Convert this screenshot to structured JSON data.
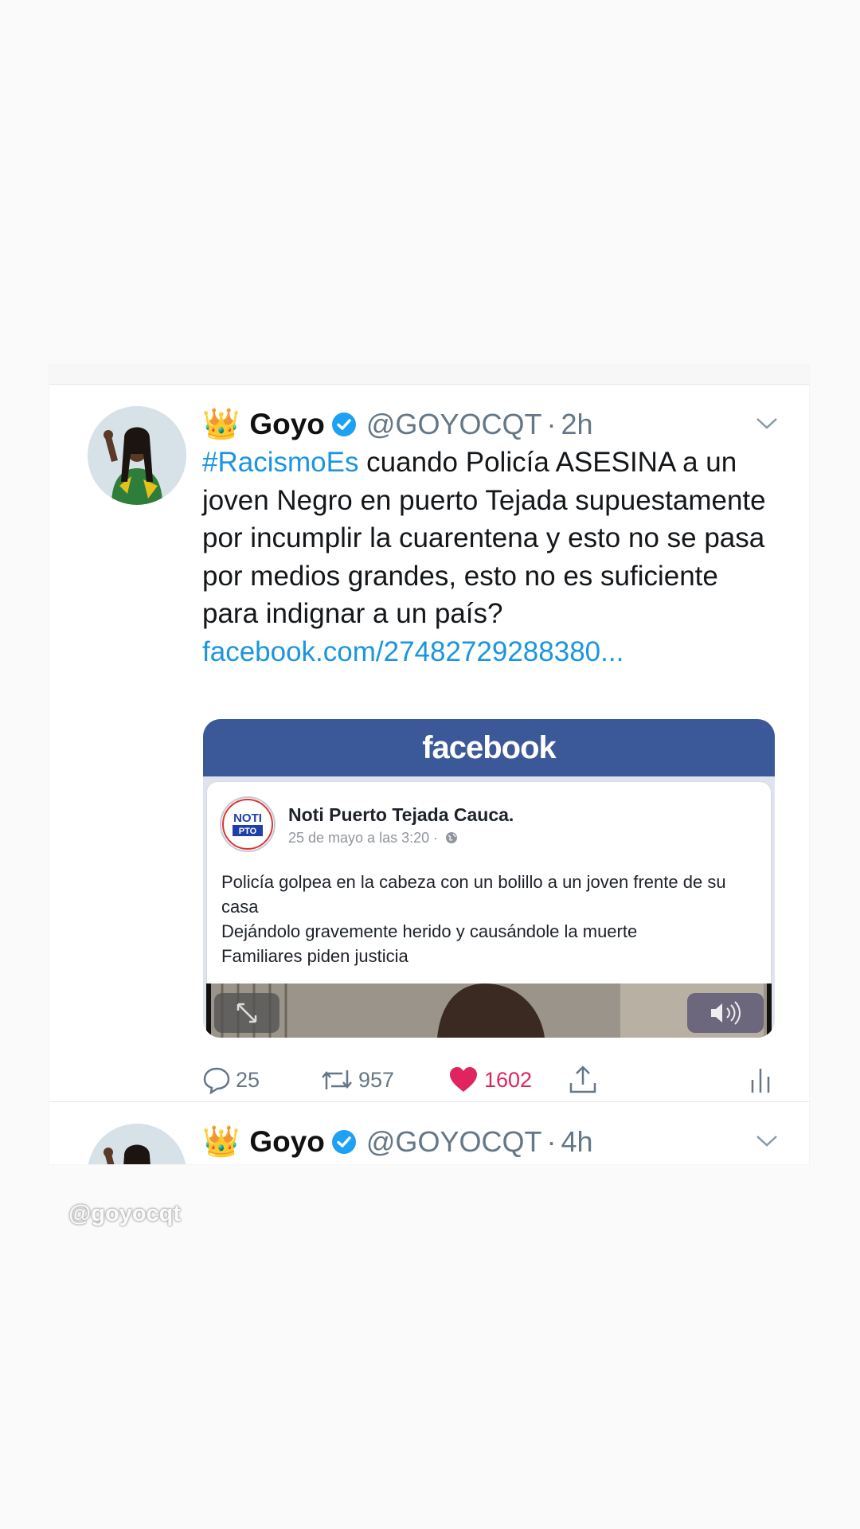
{
  "tweet": {
    "crown": "👑",
    "display_name": "Goyo",
    "handle": "@GOYOCQT",
    "separator": "·",
    "time": "2h",
    "hashtag": "#RacismoEs",
    "text": " cuando Policía ASESINA a un joven Negro en puerto Tejada supuestamente por incumplir la cuarentena y esto no se pasa por medios grandes, esto no es suficiente para indignar a un país?",
    "link": "facebook.com/27482729288380..."
  },
  "embed": {
    "brand": "facebook",
    "page_name": "Noti Puerto Tejada Cauca.",
    "date": "25 de mayo a las 3:20 ·",
    "logo_top": "NOTI",
    "logo_bottom": "PTO",
    "lines": [
      "Policía golpea en la cabeza con un bolillo a un joven frente de su casa",
      "Dejándolo gravemente herido y causándole la muerte",
      "Familiares piden justicia"
    ]
  },
  "actions": {
    "replies": "25",
    "retweets": "957",
    "likes": "1602"
  },
  "next_tweet": {
    "crown": "👑",
    "display_name": "Goyo",
    "handle": "@GOYOCQT",
    "separator": "·",
    "time": "4h"
  },
  "watermark": "@goyocqt",
  "colors": {
    "link_blue": "#1b95e0",
    "facebook_blue": "#3b5998",
    "like_red": "#e0245e",
    "verified_blue": "#1da1f2"
  }
}
